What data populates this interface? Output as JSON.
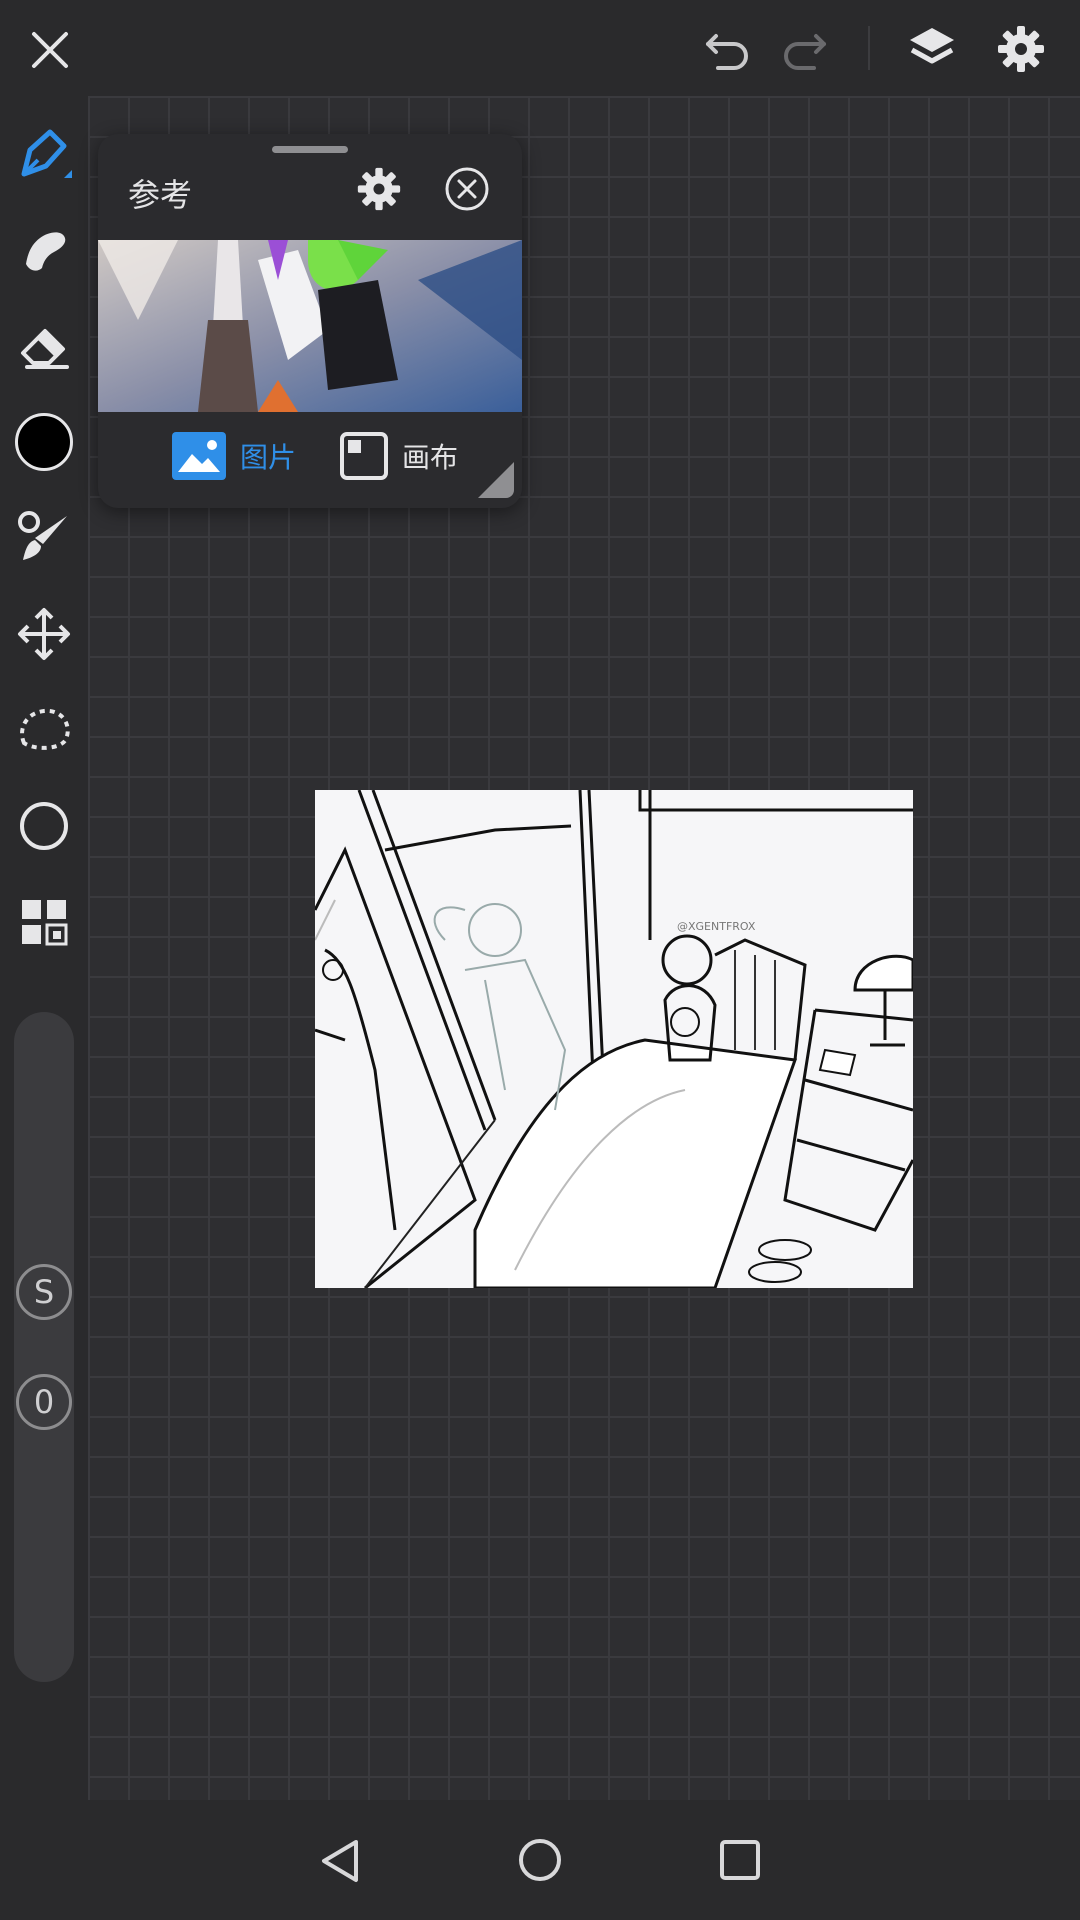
{
  "colors": {
    "accent": "#2f8fe8",
    "background": "#2b2b2e",
    "canvas_grid": "#3a3a3e",
    "icon": "#e6e6e8"
  },
  "topbar": {
    "icons": [
      "close-icon",
      "undo-icon",
      "redo-icon",
      "layers-icon",
      "settings-icon"
    ]
  },
  "toolbar": {
    "tools": [
      "pen-icon",
      "smudge-icon",
      "eraser-icon",
      "color-swatch",
      "brush-icon",
      "move-icon",
      "lasso-icon",
      "shape-icon",
      "grid-menu-icon"
    ],
    "active_tool": "pen-icon",
    "current_color": "#000000",
    "stabilizer_label": "S",
    "size_value": "0"
  },
  "reference_panel": {
    "title": "参考",
    "tabs": [
      {
        "label": "图片",
        "active": true
      },
      {
        "label": "画布",
        "active": false
      }
    ]
  },
  "artwork": {
    "watermark": "@XGENTFROX"
  },
  "navbar": {
    "icons": [
      "back-icon",
      "home-icon",
      "recents-icon"
    ]
  }
}
